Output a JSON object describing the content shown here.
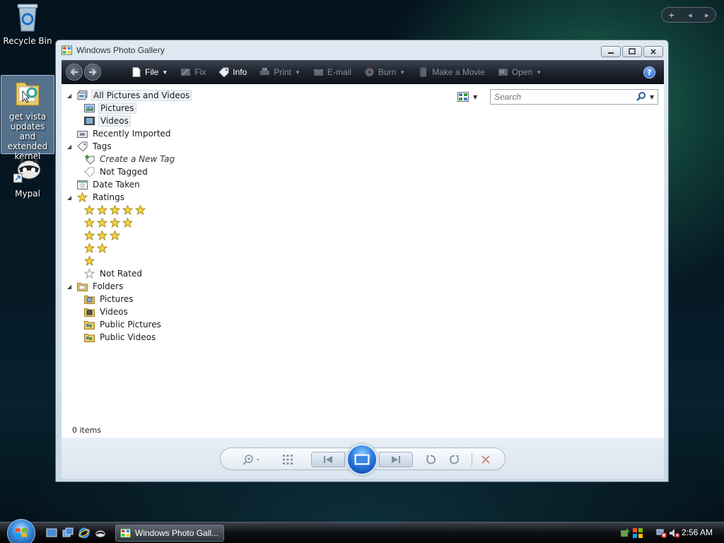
{
  "desktop": {
    "icons": [
      {
        "label": "Recycle Bin"
      },
      {
        "label": "get vista updates and extended kernel"
      },
      {
        "label": "Mypal"
      }
    ]
  },
  "gadget": {
    "add": "+",
    "prev": "◂",
    "next": "▸"
  },
  "window": {
    "title": "Windows Photo Gallery",
    "toolbar": {
      "file": "File",
      "fix": "Fix",
      "info": "Info",
      "print": "Print",
      "email": "E-mail",
      "burn": "Burn",
      "make_movie": "Make a Movie",
      "open": "Open",
      "help": "?"
    },
    "search": {
      "placeholder": "Search"
    },
    "tree": {
      "all": "All Pictures and Videos",
      "pictures": "Pictures",
      "videos": "Videos",
      "recently_imported": "Recently Imported",
      "tags": "Tags",
      "create_tag": "Create a New Tag",
      "not_tagged": "Not Tagged",
      "date_taken": "Date Taken",
      "ratings": "Ratings",
      "rating_rows": [
        5,
        4,
        3,
        2,
        1
      ],
      "not_rated": "Not Rated",
      "folders": "Folders",
      "folder_pictures": "Pictures",
      "folder_videos": "Videos",
      "public_pictures": "Public Pictures",
      "public_videos": "Public Videos"
    },
    "status": "0 items"
  },
  "taskbar": {
    "task_label": "Windows Photo Gall...",
    "clock": "2:56 AM"
  },
  "colors": {
    "toolbar_dark": "#1e242e",
    "accent_blue": "#2a7be0",
    "star": "#f5d442"
  }
}
